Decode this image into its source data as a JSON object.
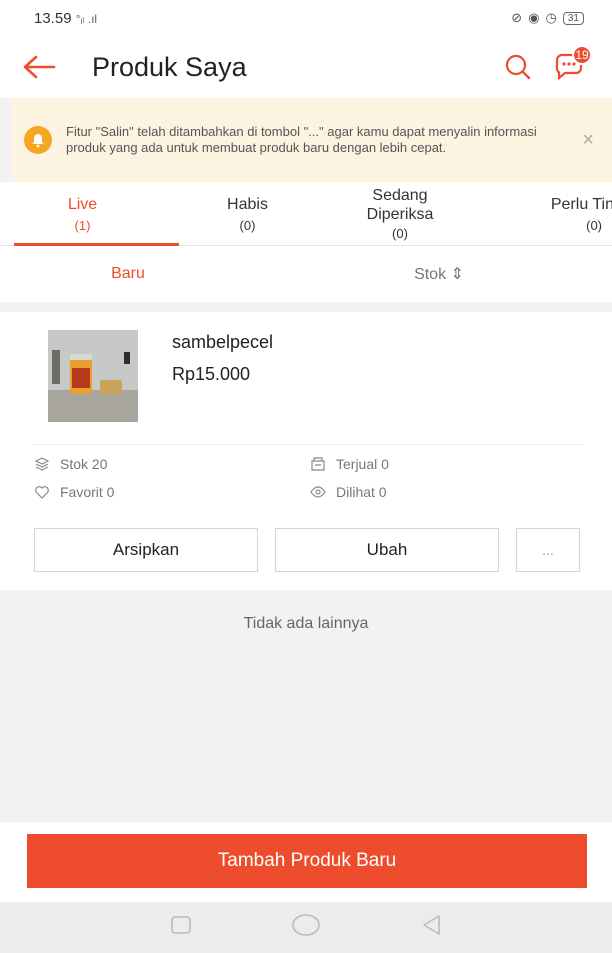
{
  "status_bar": {
    "time": "13.59",
    "signal": "°ᵢₗ .ıl",
    "battery": "31"
  },
  "header": {
    "title": "Produk Saya",
    "chat_badge": "19"
  },
  "notice": {
    "text": "Fitur \"Salin\" telah ditambahkan di tombol \"...\" agar kamu dapat menyalin informasi produk yang ada untuk membuat produk baru dengan lebih cepat.",
    "close": "×"
  },
  "tabs": [
    {
      "label": "Live",
      "count": "(1)"
    },
    {
      "label": "Habis",
      "count": "(0)"
    },
    {
      "label": "Sedang Diperiksa",
      "count": "(0)"
    },
    {
      "label": "Perlu Tin",
      "count": "(0)"
    }
  ],
  "sort": {
    "newest": "Baru",
    "stock": "Stok ⇕"
  },
  "product": {
    "name": "sambelpecel",
    "price": "Rp15.000",
    "stock": "Stok 20",
    "sold": "Terjual 0",
    "favorite": "Favorit 0",
    "views": "Dilihat 0"
  },
  "actions": {
    "archive": "Arsipkan",
    "edit": "Ubah",
    "more": "..."
  },
  "end_text": "Tidak ada lainnya",
  "add_button": "Tambah Produk Baru",
  "colors": {
    "accent": "#ee4d2d",
    "notice_bg": "#fdf3e1",
    "notice_icon": "#f6a623"
  }
}
